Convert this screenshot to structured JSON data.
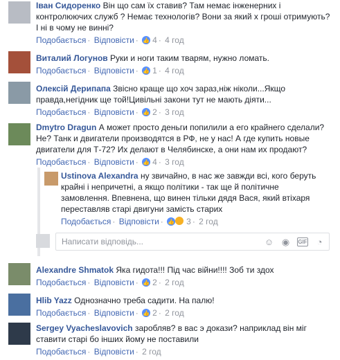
{
  "labels": {
    "like": "Подобається",
    "reply": "Відповісти",
    "sep": "·"
  },
  "comments": [
    {
      "author": "Іван Сидоренко",
      "text": "Він що сам їх ставив? Там немає інженерних і контролюючих служб ? Немає технологів? Вони за який х гроші отримують? І ні в чому не винні?",
      "reactions": "4",
      "time": "4 год"
    },
    {
      "author": "Виталий Логунов",
      "text": "Руки и ноги таким тварям, нужно ломать.",
      "reactions": "1",
      "time": "4 год"
    },
    {
      "author": "Олексій Дерипапа",
      "text": "Звісно краще що хоч зараз,ніж ніколи...Якщо правда,негідник ще той!Цивільні закони тут не мають діяти...",
      "reactions": "2",
      "time": "3 год"
    },
    {
      "author": "Dmytro Dragun",
      "text": "А может просто деньги попилили а его крайнего сделали? Не? Танк и двигатели производятся в РФ, не у нас! А где купить новые двигатели для Т-72? Их делают в Челябинске, а они нам их продают?",
      "reactions": "4",
      "time": "3 год"
    },
    {
      "author": "Ustinova Alexandra",
      "text": "ну звичайно, в нас же завжди всі, кого беруть крайні і непричетні, а якщо політики - так ще й політичне замовлення. Впевнена, що винен тільки дядя Вася, який втіхаря переставляв старі двигуни замість старих",
      "reactions": "3",
      "time": "2 год"
    },
    {
      "author": "Alexandre Shmatok",
      "text": "Яка гидота!!! Під час війни!!!! Зоб ти здох",
      "reactions": "2",
      "time": "2 год"
    },
    {
      "author": "Hlib Yazz",
      "text": "Однозначно треба садити. На палю!",
      "reactions": "2",
      "time": "2 год"
    },
    {
      "author": "Sergey Vyacheslavovich",
      "text": "заробляв? в вас э докази? наприклад він міг ставити старі бо інших йому не поставили",
      "reactions": "",
      "time": "2 год"
    }
  ],
  "reply_input": {
    "placeholder": "Написати відповідь..."
  },
  "tools": [
    "emoji-icon",
    "camera-icon",
    "gif-icon",
    "sticker-icon"
  ]
}
